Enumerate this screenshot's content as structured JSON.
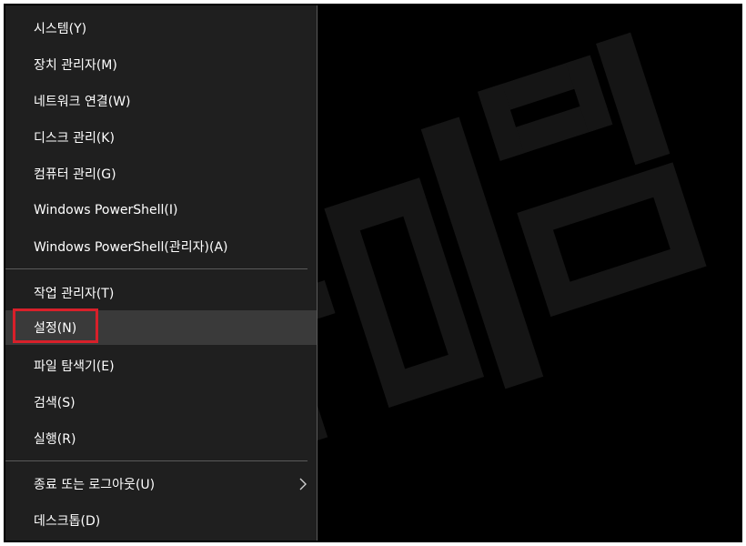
{
  "menu": {
    "items": [
      {
        "label": "시스템(Y)"
      },
      {
        "label": "장치 관리자(M)"
      },
      {
        "label": "네트워크 연결(W)"
      },
      {
        "label": "디스크 관리(K)"
      },
      {
        "label": "컴퓨터 관리(G)"
      },
      {
        "label": "Windows PowerShell(I)"
      },
      {
        "label": "Windows PowerShell(관리자)(A)"
      },
      {
        "label": "작업 관리자(T)"
      },
      {
        "label": "설정(N)"
      },
      {
        "label": "파일 탐색기(E)"
      },
      {
        "label": "검색(S)"
      },
      {
        "label": "실행(R)"
      },
      {
        "label": "종료 또는 로그아웃(U)",
        "submenu_icon": "chevron-right-icon"
      },
      {
        "label": "데스크톱(D)"
      }
    ],
    "hovered_item": "설정(N)",
    "highlighted_item": "설정(N)"
  },
  "watermark": {
    "text": "나이팁"
  },
  "colors": {
    "menu_bg": "#1f1f1f",
    "hover_bg": "#3a3a3a",
    "separator": "#5a5a5a",
    "highlight_border": "#d8202a",
    "text": "#ffffff",
    "watermark": "#141414"
  }
}
